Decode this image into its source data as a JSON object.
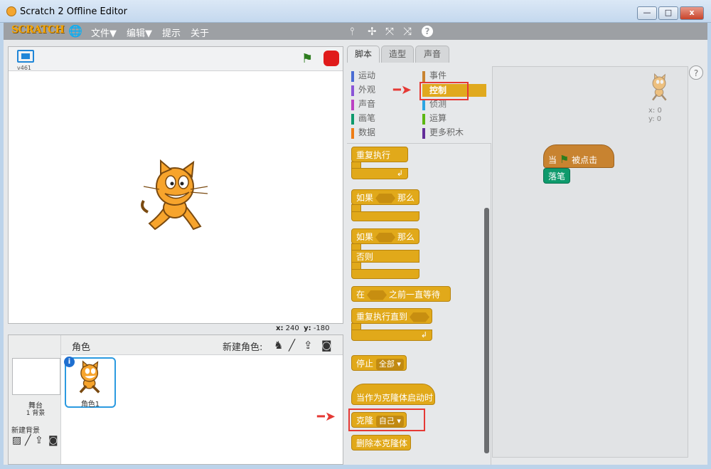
{
  "window": {
    "title": "Scratch 2 Offline Editor",
    "min_label": "—",
    "max_label": "□",
    "close_label": "x"
  },
  "menu": {
    "logo": "SCRATCH",
    "globe_icon": "globe-icon",
    "items": [
      "文件▼",
      "编辑▼",
      "提示",
      "关于"
    ]
  },
  "toolbar": {
    "icons": [
      "duplicate-icon",
      "delete-icon",
      "grow-icon",
      "shrink-icon",
      "help-icon"
    ],
    "glyphs": [
      "⫯",
      "✢",
      "⤧",
      "⤨",
      "?"
    ]
  },
  "stage": {
    "version": "v461",
    "x_label": "x:",
    "x_value": "240",
    "y_label": "y:",
    "y_value": "-180"
  },
  "sprites": {
    "header_label": "角色",
    "new_sprite_label": "新建角色:",
    "stage_label": "舞台",
    "backdrop_count": "1 背景",
    "new_backdrop_label": "新建背景",
    "sprite_name": "角色1",
    "info": "i"
  },
  "tabs": [
    "脚本",
    "造型",
    "声音"
  ],
  "categories": {
    "left": [
      {
        "label": "运动",
        "color": "#4a6cd4"
      },
      {
        "label": "外观",
        "color": "#8a55d7"
      },
      {
        "label": "声音",
        "color": "#bb42c3"
      },
      {
        "label": "画笔",
        "color": "#0e9a6c"
      },
      {
        "label": "数据",
        "color": "#ee7d16"
      }
    ],
    "right": [
      {
        "label": "事件",
        "color": "#c88330"
      },
      {
        "label": "控制",
        "color": "#e1a91a"
      },
      {
        "label": "侦测",
        "color": "#2ca5e2"
      },
      {
        "label": "运算",
        "color": "#5cb712"
      },
      {
        "label": "更多积木",
        "color": "#632d99"
      }
    ]
  },
  "blocks": {
    "forever": "重复执行",
    "if": "如果",
    "then": "那么",
    "else": "否则",
    "wait_until_pre": "在",
    "wait_until_post": "之前一直等待",
    "repeat_until": "重复执行直到",
    "stop": "停止",
    "stop_option": "全部",
    "clone_start": "当作为克隆体启动时",
    "clone": "克隆",
    "clone_option": "自己",
    "delete_clone": "删除本克隆体"
  },
  "script": {
    "hat_pre": "当",
    "hat_post": "被点击",
    "pen_block": "落笔",
    "sprite_x": "x: 0",
    "sprite_y": "y: 0"
  },
  "help": "?"
}
